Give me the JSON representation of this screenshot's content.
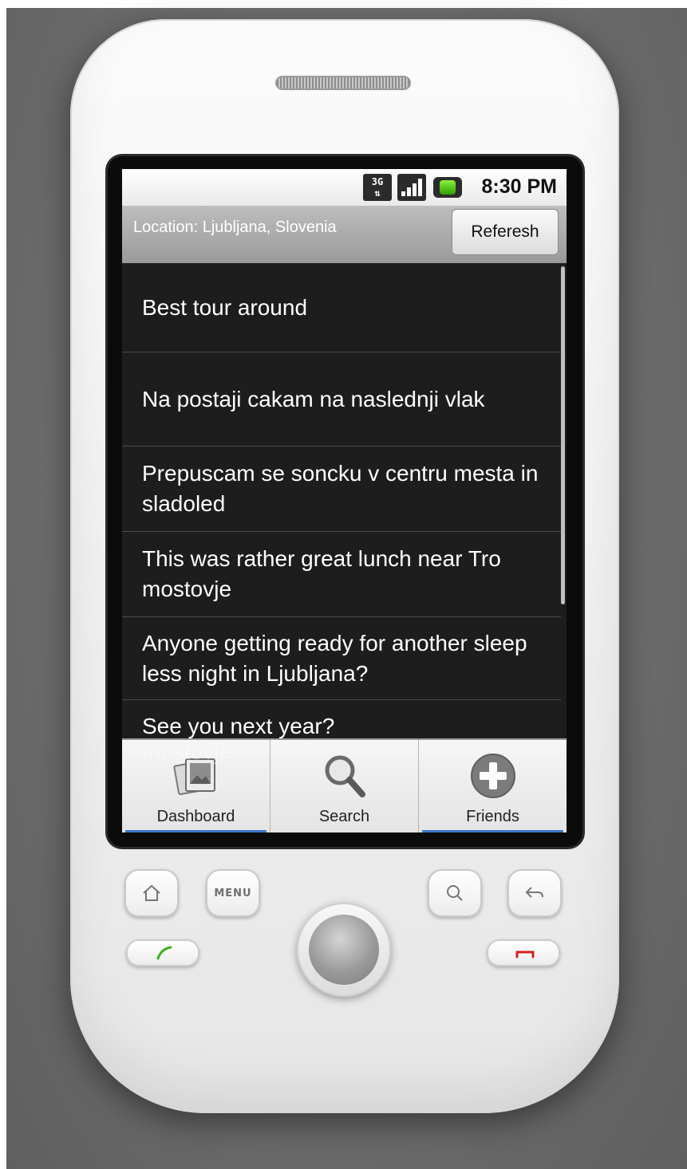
{
  "status_bar": {
    "network_badge": "3G",
    "time": "8:30 PM",
    "icons": [
      "3g-icon",
      "signal-icon",
      "battery-icon"
    ],
    "battery_color": "#3fbf1a"
  },
  "header": {
    "location_text": "Location: Ljubljana, Slovenia",
    "refresh_label": "Referesh"
  },
  "feed": {
    "items": [
      "Best tour around",
      "Na postaji cakam na naslednji vlak",
      "Prepuscam se soncku v centru mesta in sladoled",
      "This was rather great lunch near Tro mostovje",
      "Anyone getting ready for another sleep less night in Ljubljana?",
      "See you next year?"
    ],
    "overlap_text": "mostovje"
  },
  "tabs": [
    {
      "label": "Dashboard",
      "icon": "photos-icon"
    },
    {
      "label": "Search",
      "icon": "search-icon"
    },
    {
      "label": "Friends",
      "icon": "add-icon"
    }
  ],
  "hardware": {
    "menu_label": "MENU",
    "call_color": "#3cb21e",
    "end_color": "#d22020"
  },
  "colors": {
    "tab_underline": "#3a78c8",
    "list_background": "#1d1d1d"
  }
}
